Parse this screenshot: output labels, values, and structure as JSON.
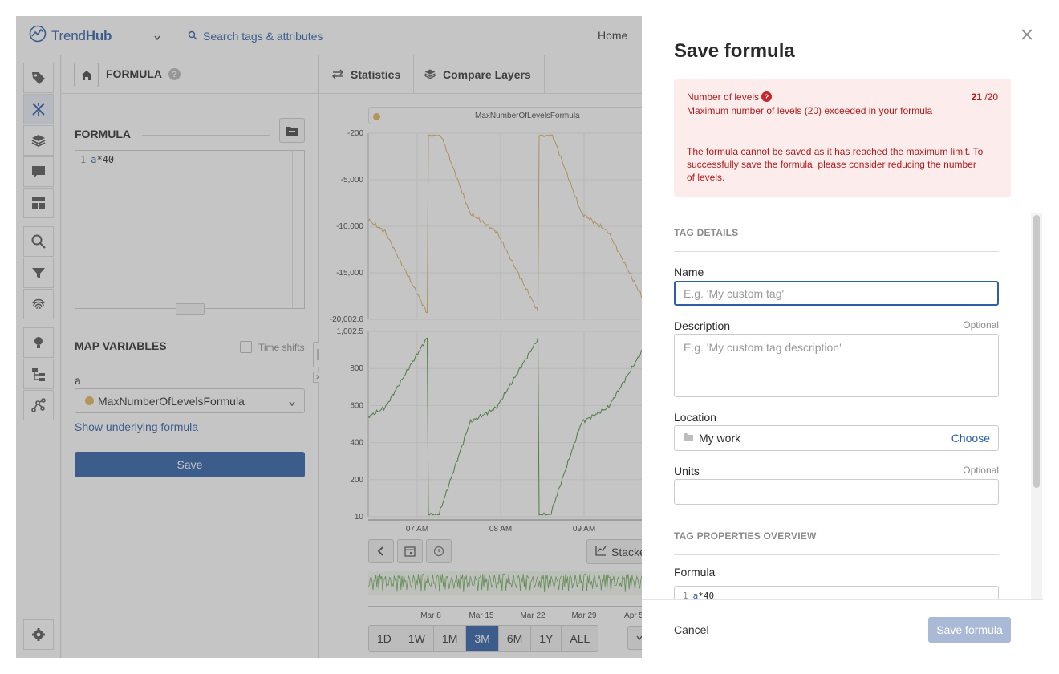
{
  "app": {
    "brand_prefix": "Trend",
    "brand_suffix": "Hub",
    "search_placeholder": "Search tags & attributes",
    "home_link": "Home"
  },
  "formula_panel": {
    "title": "FORMULA",
    "section_formula": "FORMULA",
    "editor_line_number": "1",
    "editor_var": "a",
    "editor_rest": "*40",
    "section_map": "MAP VARIABLES",
    "time_shifts_label": "Time shifts",
    "variable_name": "a",
    "variable_value": "MaxNumberOfLevelsFormula",
    "variable_color": "#e3b65a",
    "show_underlying": "Show underlying formula",
    "save_label": "Save"
  },
  "chart_panel": {
    "tab_statistics": "Statistics",
    "tab_compare": "Compare Layers",
    "legend_label": "MaxNumberOfLevelsFormula",
    "stacked_label": "Stacked",
    "ranges": [
      "1D",
      "1W",
      "1M",
      "3M",
      "6M",
      "1Y",
      "ALL"
    ],
    "selected_range": "3M"
  },
  "chart_data": [
    {
      "type": "line",
      "series": [
        {
          "name": "MaxNumberOfLevelsFormula",
          "color": "#d8b062"
        }
      ],
      "yticks": [
        "-200",
        "-5,000",
        "-10,000",
        "-15,000",
        "-20,002.6"
      ],
      "ylim": [
        -20002.6,
        -200
      ],
      "xticks": [
        "07 AM",
        "08 AM",
        "09 AM"
      ]
    },
    {
      "type": "line",
      "series": [
        {
          "name": "",
          "color": "#4e8f3a"
        }
      ],
      "yticks": [
        "1,002.5",
        "800",
        "600",
        "400",
        "200",
        "10"
      ],
      "ylim": [
        10,
        1002.5
      ],
      "xticks": [
        "07 AM",
        "08 AM",
        "09 AM"
      ]
    },
    {
      "type": "line",
      "series": [
        {
          "name": "",
          "color": "#6da85a"
        }
      ],
      "xticks": [
        "Mar 8",
        "Mar 15",
        "Mar 22",
        "Mar 29",
        "Apr 5"
      ]
    }
  ],
  "modal": {
    "title": "Save formula",
    "alert_title": "Number of levels",
    "alert_count_current": "21",
    "alert_count_max": "/20",
    "alert_subtitle": "Maximum number of levels (20) exceeded in your formula",
    "alert_body": "The formula cannot be saved as it has reached the maximum limit. To successfully save the formula, please consider reducing the number of levels.",
    "section_details": "TAG DETAILS",
    "name_label": "Name",
    "name_placeholder": "E.g. 'My custom tag'",
    "description_label": "Description",
    "description_optional": "Optional",
    "description_placeholder": "E.g. 'My custom tag description'",
    "location_label": "Location",
    "location_value": "My work",
    "location_action": "Choose",
    "units_label": "Units",
    "units_optional": "Optional",
    "section_properties": "TAG PROPERTIES OVERVIEW",
    "formula_label": "Formula",
    "formula_line_number": "1",
    "formula_var": "a",
    "formula_rest": "*40",
    "cancel_label": "Cancel",
    "save_label": "Save formula"
  },
  "colors": {
    "accent": "#2d5fa8",
    "error": "#b01c1c",
    "error_bg": "#fdecec"
  }
}
